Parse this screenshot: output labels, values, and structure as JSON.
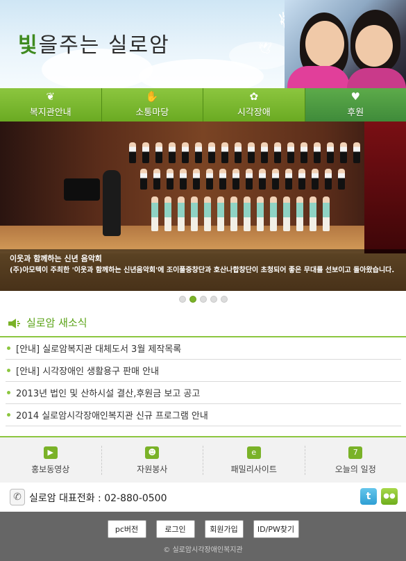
{
  "header": {
    "logo_highlight": "빛",
    "logo_rest": "을주는 실로암"
  },
  "nav": [
    {
      "label": "복지관안내",
      "icon": "leaf-icon"
    },
    {
      "label": "소통마당",
      "icon": "handshake-icon"
    },
    {
      "label": "시각장애",
      "icon": "sprout-icon"
    },
    {
      "label": "후원",
      "icon": "hands-icon"
    }
  ],
  "slide": {
    "title": "이웃과 함께하는 신년 음악회",
    "description": "(주)아모텍이 주최한 '이웃과 함께하는 신년음악회'에 조이풀중창단과 호산나합창단이 초청되어 좋은 무대를 선보이고 돌아왔습니다.",
    "dot_count": 5,
    "active_dot": 2
  },
  "news": {
    "title": "실로암 새소식",
    "items": [
      "[안내] 실로암복지관 대체도서 3월 제작목록",
      "[안내] 시각장애인 생활용구 판매 안내",
      "2013년 법인 및 산하시설 결산,후원금 보고 공고",
      "2014 실로암시각장애인복지관 신규 프로그램 안내"
    ]
  },
  "quick": [
    {
      "label": "홍보동영상",
      "icon": "video-icon"
    },
    {
      "label": "자원봉사",
      "icon": "people-icon"
    },
    {
      "label": "패밀리사이트",
      "icon": "family-site-icon"
    },
    {
      "label": "오늘의 일정",
      "icon": "calendar-icon"
    }
  ],
  "phone": {
    "text": "실로암 대표전화 : 02-880-0500"
  },
  "footer": {
    "buttons": [
      "pc버전",
      "로그인",
      "회원가입",
      "ID/PW찾기"
    ],
    "copyright": "© 실로암시각장애인복지관"
  },
  "colors": {
    "accent": "#8cc63f",
    "accent_dark": "#5aa316",
    "footer_bg": "#666666"
  }
}
